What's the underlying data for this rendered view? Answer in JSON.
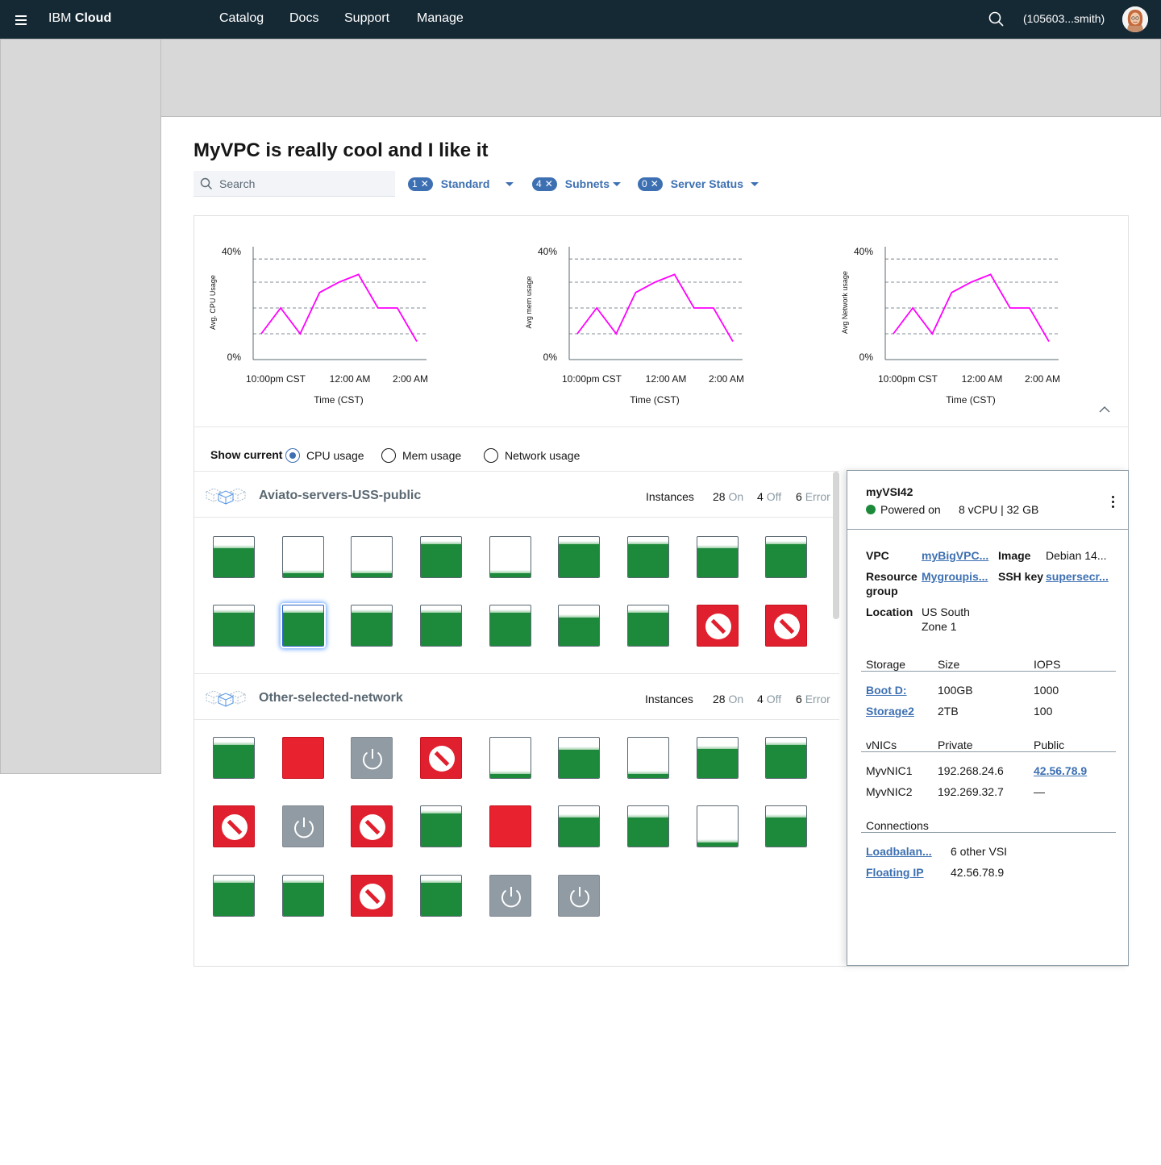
{
  "topbar": {
    "brand_prefix": "IBM",
    "brand_bold": "Cloud",
    "nav": [
      "Catalog",
      "Docs",
      "Support",
      "Manage"
    ],
    "account": "(105603...smith)"
  },
  "page": {
    "title": "MyVPC is really cool and I like it",
    "search_placeholder": "Search"
  },
  "filters": [
    {
      "count": "1",
      "label": "Standard"
    },
    {
      "count": "4",
      "label": "Subnets"
    },
    {
      "count": "0",
      "label": "Server Status"
    }
  ],
  "charts": [
    {
      "ylabel": "Avg. CPU Usage",
      "xlabel": "Time (CST)"
    },
    {
      "ylabel": "Avg mem usage",
      "xlabel": "Time (CST)"
    },
    {
      "ylabel": "Avg Network usage",
      "xlabel": "Time (CST)"
    }
  ],
  "chart_data": [
    {
      "type": "line",
      "title": "",
      "xlabel": "Time (CST)",
      "ylabel": "Avg. CPU Usage",
      "y_ticks": [
        "0%",
        "40%"
      ],
      "x_ticks": [
        "10:00pm CST",
        "12:00 AM",
        "2:00 AM"
      ],
      "ylim": [
        0,
        40
      ],
      "grid": "dashed horizontal",
      "color": "#ff00ff",
      "series": [
        {
          "values": [
            10,
            20,
            10,
            26,
            30,
            33,
            20,
            20,
            7
          ]
        }
      ]
    },
    {
      "type": "line",
      "title": "",
      "xlabel": "Time (CST)",
      "ylabel": "Avg mem usage",
      "y_ticks": [
        "0%",
        "40%"
      ],
      "x_ticks": [
        "10:00pm CST",
        "12:00 AM",
        "2:00 AM"
      ],
      "ylim": [
        0,
        40
      ],
      "grid": "dashed horizontal",
      "color": "#ff00ff",
      "series": [
        {
          "values": [
            10,
            20,
            10,
            26,
            30,
            33,
            20,
            20,
            7
          ]
        }
      ]
    },
    {
      "type": "line",
      "title": "",
      "xlabel": "Time (CST)",
      "ylabel": "Avg Network usage",
      "y_ticks": [
        "0%",
        "40%"
      ],
      "x_ticks": [
        "10:00pm CST",
        "12:00 AM",
        "2:00 AM"
      ],
      "ylim": [
        0,
        40
      ],
      "grid": "dashed horizontal",
      "color": "#ff00ff",
      "series": [
        {
          "values": [
            10,
            20,
            10,
            26,
            30,
            33,
            20,
            20,
            7
          ]
        }
      ]
    }
  ],
  "show_current": {
    "label": "Show current",
    "options": [
      "CPU usage",
      "Mem usage",
      "Network usage"
    ],
    "selected": "CPU usage"
  },
  "groups": [
    {
      "name": "Aviato-servers-USS-public",
      "instances_label": "Instances",
      "on_count": "28",
      "on_label": "On",
      "off_count": "4",
      "off_label": "Off",
      "error_count": "6",
      "error_label": "Error",
      "tiles": [
        {
          "state": "on",
          "level": 0.72
        },
        {
          "state": "on",
          "level": 0.1
        },
        {
          "state": "on",
          "level": 0.1
        },
        {
          "state": "on",
          "level": 0.82
        },
        {
          "state": "on",
          "level": 0.1
        },
        {
          "state": "on",
          "level": 0.82
        },
        {
          "state": "on",
          "level": 0.82
        },
        {
          "state": "on",
          "level": 0.72
        },
        {
          "state": "on",
          "level": 0.82
        },
        {
          "state": "on",
          "level": 0.82
        },
        {
          "state": "on",
          "level": 0.82,
          "selected": true
        },
        {
          "state": "on",
          "level": 0.82
        },
        {
          "state": "on",
          "level": 0.82
        },
        {
          "state": "on",
          "level": 0.82
        },
        {
          "state": "on",
          "level": 0.7
        },
        {
          "state": "on",
          "level": 0.82
        },
        {
          "state": "error"
        },
        {
          "state": "error"
        }
      ]
    },
    {
      "name": "Other-selected-network",
      "instances_label": "Instances",
      "on_count": "28",
      "on_label": "On",
      "off_count": "4",
      "off_label": "Off",
      "error_count": "6",
      "error_label": "Error",
      "tiles": [
        {
          "state": "on",
          "level": 0.82
        },
        {
          "state": "alert"
        },
        {
          "state": "off"
        },
        {
          "state": "error"
        },
        {
          "state": "on",
          "level": 0.1
        },
        {
          "state": "on",
          "level": 0.7
        },
        {
          "state": "on",
          "level": 0.1
        },
        {
          "state": "on",
          "level": 0.72
        },
        {
          "state": "on",
          "level": 0.82
        },
        {
          "state": "error"
        },
        {
          "state": "off"
        },
        {
          "state": "error"
        },
        {
          "state": "on",
          "level": 0.82
        },
        {
          "state": "alert"
        },
        {
          "state": "on",
          "level": 0.72
        },
        {
          "state": "on",
          "level": 0.72
        },
        {
          "state": "on",
          "level": 0.1
        },
        {
          "state": "on",
          "level": 0.72
        },
        {
          "state": "on",
          "level": 0.82
        },
        {
          "state": "on",
          "level": 0.82
        },
        {
          "state": "error"
        },
        {
          "state": "on",
          "level": 0.82
        },
        {
          "state": "off"
        },
        {
          "state": "off"
        }
      ]
    }
  ],
  "details": {
    "name": "myVSI42",
    "status": "Powered on",
    "spec": "8 vCPU | 32 GB",
    "vpc_label": "VPC",
    "vpc_value": "myBigVPC...",
    "image_label": "Image",
    "image_value": "Debian 14...",
    "rg_label_1": "Resource",
    "rg_label_2": "group",
    "rg_value": "Mygroupis...",
    "ssh_label": "SSH key",
    "ssh_value": "supersecr...",
    "location_label": "Location",
    "location_value_1": "US South",
    "location_value_2": "Zone 1",
    "storage": {
      "headers": [
        "Storage",
        "Size",
        "IOPS"
      ],
      "rows": [
        [
          "Boot D:",
          "100GB",
          "1000"
        ],
        [
          "Storage2",
          "2TB",
          "100"
        ]
      ]
    },
    "vnics": {
      "headers": [
        "vNICs",
        "Private",
        "Public"
      ],
      "rows": [
        [
          "MyvNIC1",
          "192.268.24.6",
          "42.56.78.9"
        ],
        [
          "MyvNIC2",
          "192.269.32.7",
          "—"
        ]
      ]
    },
    "connections": {
      "header": "Connections",
      "rows": [
        [
          "Loadbalan...",
          "6 other VSI"
        ],
        [
          "Floating IP",
          "42.56.78.9"
        ]
      ]
    }
  },
  "colors": {
    "topbar": "#152935",
    "accent": "#3d70b2",
    "on": "#1c8a3a",
    "error": "#e0202e",
    "off": "#919ba3",
    "series": "#ff00ff"
  }
}
